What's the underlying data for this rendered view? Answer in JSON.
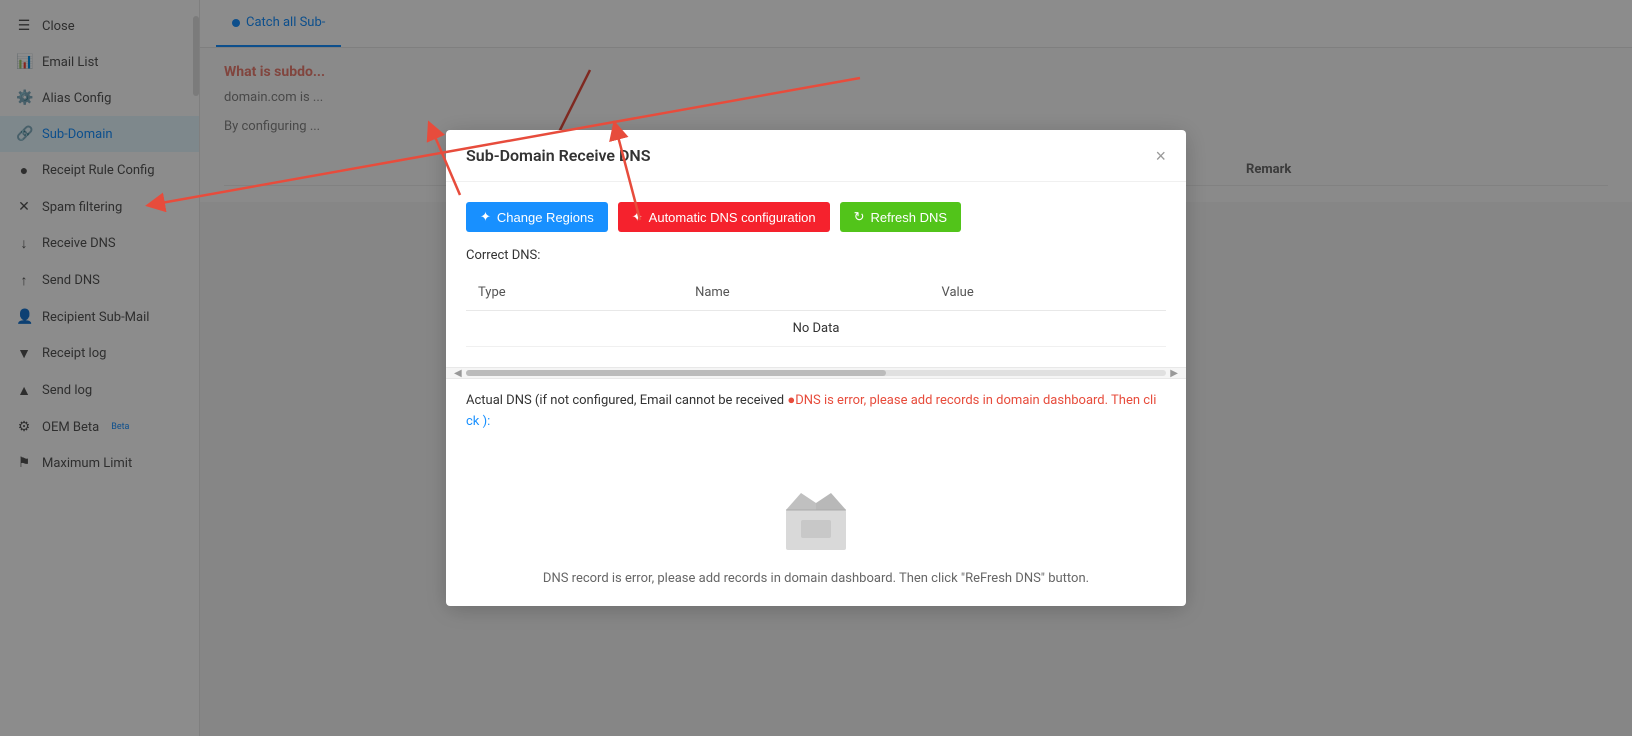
{
  "sidebar": {
    "items": [
      {
        "id": "close",
        "label": "Close",
        "icon": "☰",
        "active": false
      },
      {
        "id": "email-list",
        "label": "Email List",
        "icon": "📊",
        "active": false
      },
      {
        "id": "alias-config",
        "label": "Alias Config",
        "icon": "⚙️",
        "active": false
      },
      {
        "id": "sub-domain",
        "label": "Sub-Domain",
        "icon": "🔗",
        "active": true
      },
      {
        "id": "receipt-rule",
        "label": "Receipt Rule Config",
        "icon": "●",
        "active": false
      },
      {
        "id": "spam-filtering",
        "label": "Spam filtering",
        "icon": "✕",
        "active": false
      },
      {
        "id": "receive-dns",
        "label": "Receive DNS",
        "icon": "↓",
        "active": false
      },
      {
        "id": "send-dns",
        "label": "Send DNS",
        "icon": "↑",
        "active": false
      },
      {
        "id": "recipient-sub",
        "label": "Recipient Sub-Mail",
        "icon": "👤",
        "active": false
      },
      {
        "id": "receipt-log",
        "label": "Receipt log",
        "icon": "▼",
        "active": false
      },
      {
        "id": "send-log",
        "label": "Send log",
        "icon": "▲",
        "active": false
      },
      {
        "id": "oem-beta",
        "label": "OEM Beta",
        "icon": "⚙",
        "active": false
      },
      {
        "id": "max-limit",
        "label": "Maximum Limit",
        "icon": "⚑",
        "active": false
      }
    ]
  },
  "tab": {
    "label": "Catch all Sub-"
  },
  "background": {
    "subtitle": "What is subdo...",
    "desc1": "domain.com is ...",
    "desc2": "By configuring ...",
    "table_cols": [
      "",
      "",
      "",
      "Remark"
    ],
    "remark_header": "Remark"
  },
  "modal": {
    "title": "Sub-Domain Receive DNS",
    "close_label": "×",
    "buttons": {
      "change_regions": "Change Regions",
      "auto_dns": "Automatic DNS configuration",
      "refresh_dns": "Refresh DNS"
    },
    "correct_dns_label": "Correct DNS:",
    "table": {
      "columns": [
        "Type",
        "Name",
        "Value"
      ],
      "no_data": "No Data"
    },
    "actual_dns_label": "Actual DNS (if not configured, Email cannot be received ",
    "dns_error": "●DNS is error, please add records in domain dashboard. Then cli",
    "dns_click": "ck ):",
    "empty_state": {
      "text": "DNS record is error, please add records in domain dashboard. Then click \"ReFresh DNS\" button."
    }
  }
}
